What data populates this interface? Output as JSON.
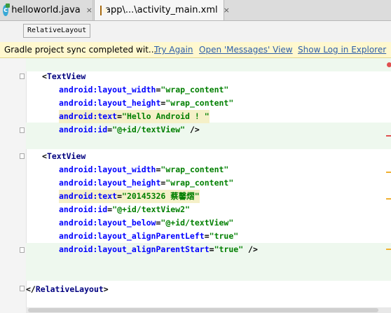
{
  "tabs": [
    {
      "label": "helloworld.java",
      "close": "×"
    },
    {
      "label": "app\\...\\activity_main.xml",
      "close": "×"
    }
  ],
  "breadcrumb": {
    "label": "RelativeLayout"
  },
  "notification": {
    "message": "Gradle project sync completed wit...",
    "links": [
      "Try Again",
      "Open 'Messages' View",
      "Show Log in Explorer"
    ]
  },
  "code": [
    {
      "lt": "<",
      "tag": "TextView"
    },
    {
      "attr": "android:layout_width",
      "val": "\"wrap_content\""
    },
    {
      "attr": "android:layout_height",
      "val": "\"wrap_content\""
    },
    {
      "attr": "android:text",
      "val": "\"Hello Android ! \""
    },
    {
      "attr": "android:id",
      "val": "\"@+id/textView\"",
      "end": " />"
    },
    {
      "lt": "<",
      "tag": "TextView"
    },
    {
      "attr": "android:layout_width",
      "val": "\"wrap_content\""
    },
    {
      "attr": "android:layout_height",
      "val": "\"wrap_content\""
    },
    {
      "attr": "android:text",
      "val": "\"20145326 蔡馨熠\""
    },
    {
      "attr": "android:id",
      "val": "\"@+id/textView2\""
    },
    {
      "attr": "android:layout_below",
      "val": "\"@+id/textView\""
    },
    {
      "attr": "android:layout_alignParentLeft",
      "val": "\"true\""
    },
    {
      "attr": "android:layout_alignParentStart",
      "val": "\"true\"",
      "end": " />"
    },
    {
      "lt": "</",
      "tag": "RelativeLayout",
      "gt": ">"
    }
  ],
  "colors": {
    "tag": "#000080",
    "attribute": "#0000ff",
    "value": "#007f00",
    "link": "#2d5ea8",
    "notification_bg": "#fff8cf"
  }
}
